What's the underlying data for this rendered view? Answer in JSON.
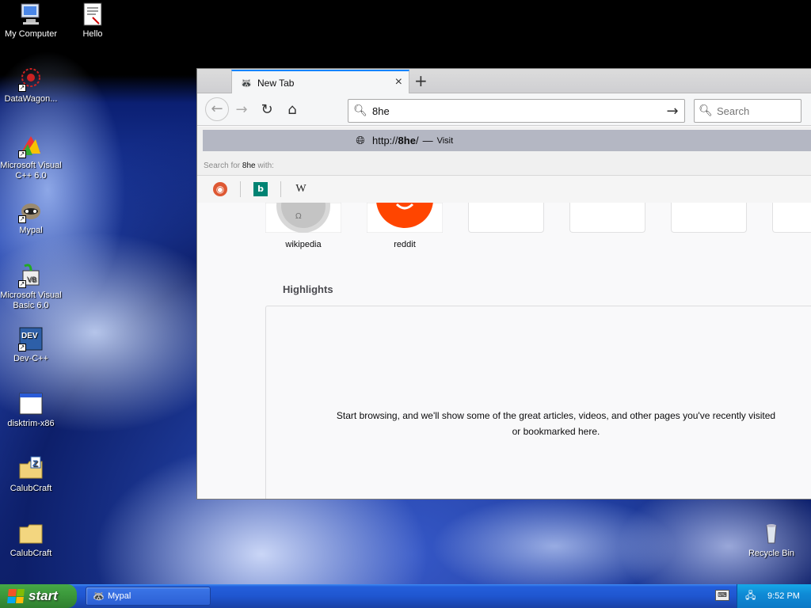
{
  "desktop": {
    "icons": [
      {
        "label": "My Computer",
        "glyph": "🖥"
      },
      {
        "label": "Hello",
        "glyph": "📄"
      },
      {
        "label": "DataWagon...",
        "glyph": "✺"
      },
      {
        "label": "Microsoft Visual C++ 6.0",
        "glyph": "◆"
      },
      {
        "label": "Mypal",
        "glyph": "🦝"
      },
      {
        "label": "Microsoft Visual Basic 6.0",
        "glyph": "⚙"
      },
      {
        "label": "Dev-C++",
        "glyph": "DEV"
      },
      {
        "label": "disktrim-x86",
        "glyph": "▭"
      },
      {
        "label": "CalubCraft",
        "glyph": "Z"
      },
      {
        "label": "CalubCraft",
        "glyph": "📁"
      },
      {
        "label": "Recycle Bin",
        "glyph": "🗑"
      }
    ]
  },
  "browser": {
    "tab_title": "New Tab",
    "tab_close": "×",
    "new_tab": "+",
    "url_value": "8he",
    "search_placeholder": "Search",
    "dropdown": {
      "url_prefix": "http://",
      "url_bold": "8he",
      "url_suffix": "/",
      "dash": "—",
      "visit": "Visit",
      "hint_prefix": "Search for ",
      "hint_term": "8he",
      "hint_suffix": " with:"
    },
    "topsites": [
      {
        "label": "wikipedia"
      },
      {
        "label": "reddit"
      }
    ],
    "highlights_title": "Highlights",
    "highlights_empty": "Start browsing, and we'll show some of the great articles, videos, and other pages you've recently visited or bookmarked here."
  },
  "taskbar": {
    "start_label": "start",
    "task_label": "Mypal",
    "clock": "9:52 PM"
  }
}
